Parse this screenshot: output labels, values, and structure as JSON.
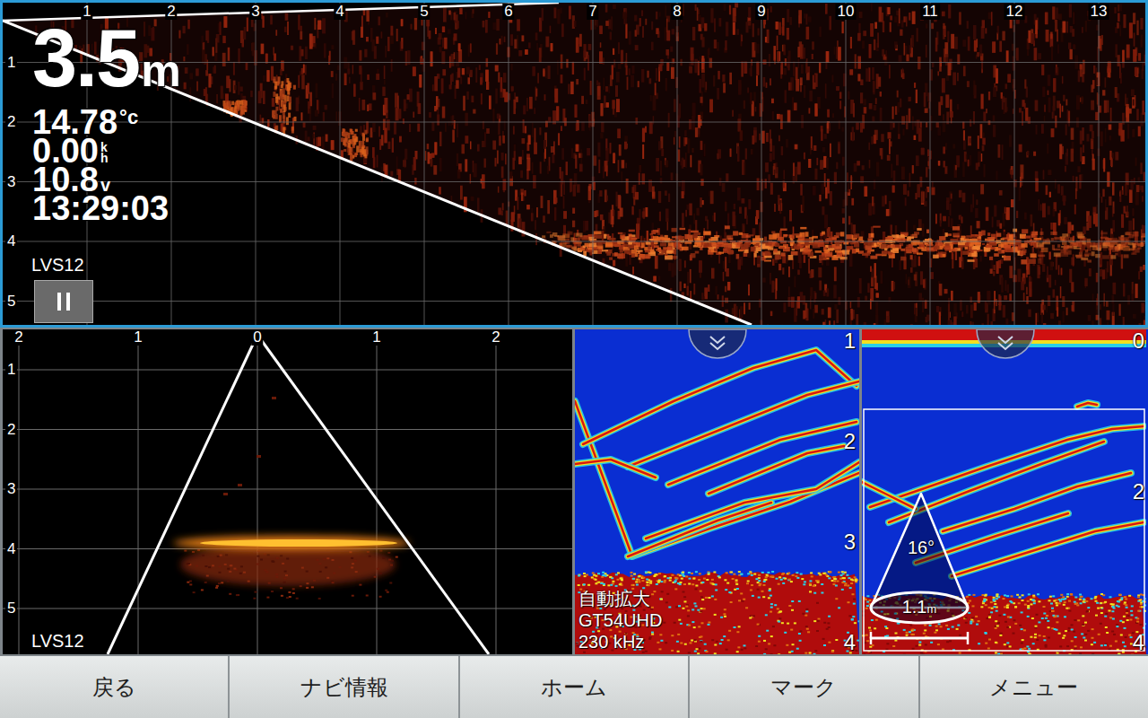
{
  "forward_view": {
    "x_ticks": [
      "1",
      "2",
      "3",
      "4",
      "5",
      "6",
      "7",
      "8",
      "9",
      "10",
      "11",
      "12",
      "13"
    ],
    "y_ticks": [
      "1",
      "2",
      "3",
      "4",
      "5"
    ],
    "label": "LVS12"
  },
  "readouts": {
    "depth": {
      "value": "3.5",
      "unit": "m"
    },
    "temperature": {
      "value": "14.78",
      "unit": "°c"
    },
    "speed": {
      "value": "0.00",
      "unit_top": "k",
      "unit_bottom": "h"
    },
    "voltage": {
      "value": "10.8",
      "unit": "v"
    },
    "time": "13:29:03"
  },
  "down_view": {
    "x_ticks": [
      "2",
      "1",
      "0",
      "1",
      "2"
    ],
    "y_ticks": [
      "1",
      "2",
      "3",
      "4",
      "5"
    ],
    "label": "LVS12"
  },
  "sonar_panels": [
    {
      "kind": "traditional",
      "depth_ticks": [
        "1",
        "2",
        "3",
        "4"
      ],
      "info": [
        "自動拡大",
        "GT54UHD",
        "230 kHz"
      ]
    },
    {
      "kind": "zoom",
      "depth_ticks": [
        "0",
        "2",
        "4"
      ],
      "cone": {
        "angle": "16°",
        "width": "1.1",
        "unit": "m"
      }
    }
  ],
  "softkeys": [
    {
      "label": "戻る"
    },
    {
      "label": "ナビ情報"
    },
    {
      "label": "ホーム"
    },
    {
      "label": "マーク"
    },
    {
      "label": "メニュー"
    }
  ]
}
